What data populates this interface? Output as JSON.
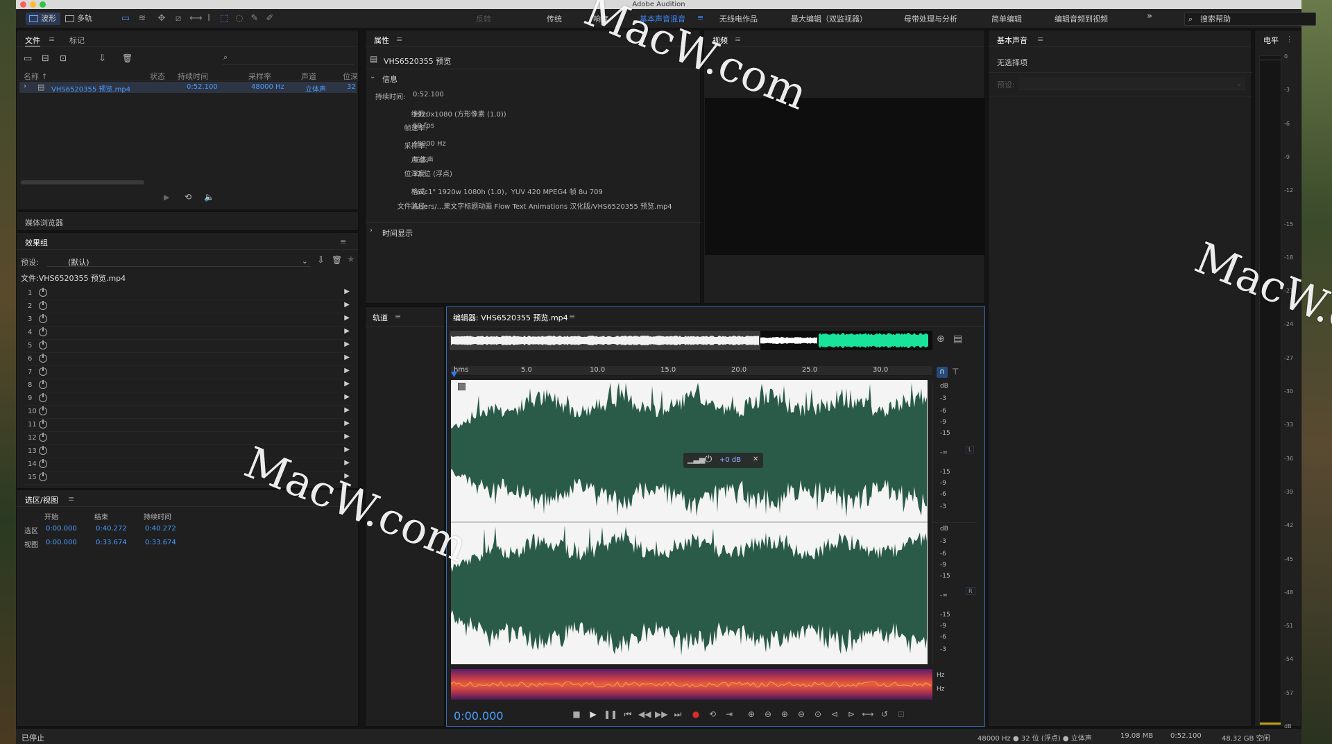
{
  "window": {
    "title": "Adobe Audition"
  },
  "toolbar": {
    "waveform_label": "波形",
    "multitrack_label": "多轨",
    "workspaces": [
      "反转",
      "传统",
      "响度",
      "基本声音混音",
      "无线电作品",
      "最大编辑（双监视器）",
      "母带处理与分析",
      "简单编辑",
      "编辑音频到视频"
    ],
    "active_workspace": "基本声音混音",
    "more_label": "»",
    "search_placeholder": "搜索帮助"
  },
  "files_panel": {
    "tab_files": "文件",
    "tab_markers": "标记",
    "columns": [
      "名称 ↑",
      "状态",
      "持续时间",
      "采样率",
      "声道",
      "位深"
    ],
    "file": {
      "name": "VHS6520355 预览.mp4",
      "duration": "0:52.100",
      "sample_rate": "48000 Hz",
      "channels": "立体声",
      "bit_depth": "32"
    }
  },
  "media_browser": {
    "title": "媒体浏览器"
  },
  "effects_rack": {
    "title": "效果组",
    "preset_label": "预设:",
    "preset_value": "(默认)",
    "file_label": "文件:VHS6520355 预览.mp4",
    "slots": [
      "1",
      "2",
      "3",
      "4",
      "5",
      "6",
      "7",
      "8",
      "9",
      "10",
      "11",
      "12",
      "13",
      "14",
      "15"
    ]
  },
  "selection_view": {
    "title": "选区/视图",
    "headers": [
      "开始",
      "结束",
      "持续时间"
    ],
    "selection": {
      "label": "选区",
      "start": "0:00.000",
      "end": "0:40.272",
      "duration": "0:40.272"
    },
    "view": {
      "label": "视图",
      "start": "0:00.000",
      "end": "0:33.674",
      "duration": "0:33.674"
    }
  },
  "properties": {
    "title": "属性",
    "file_name": "VHS6520355 预览",
    "info_title": "信息",
    "duration_label": "持续时间:",
    "duration_value": "0:52.100",
    "fields": [
      {
        "label": "维数:",
        "value": "1920x1080 (方形像素 (1.0))"
      },
      {
        "label": "帧速率:",
        "value": "60 fps"
      },
      {
        "label": "采样率:",
        "value": "48000 Hz"
      },
      {
        "label": "声道:",
        "value": "立体声"
      },
      {
        "label": "位深度:",
        "value": "32 位 (浮点)"
      },
      {
        "label": "格式:",
        "value": "\"avc1\" 1920w 1080h (1.0)，YUV 420 MPEG4 帧 8u 709"
      },
      {
        "label": "文件路径:",
        "value": "/Users/...果文字标题动画 Flow Text Animations 汉化版/VHS6520355 预览.mp4"
      }
    ],
    "time_display": "时间显示"
  },
  "video_panel": {
    "title": "视频"
  },
  "essential_sound": {
    "title": "基本声音",
    "no_selection": "无选择项",
    "preset_label": "预设:"
  },
  "level_meter": {
    "title": "电平",
    "scale": [
      "0",
      "-3",
      "-6",
      "-9",
      "-12",
      "-15",
      "-18",
      "-21",
      "-24",
      "-27",
      "-30",
      "-33",
      "-36",
      "-39",
      "-42",
      "-45",
      "-48",
      "-51",
      "-54",
      "-57",
      "dB"
    ]
  },
  "tracks_panel": {
    "title": "轨道"
  },
  "editor": {
    "title": "编辑器: VHS6520355 预览.mp4",
    "ruler": [
      "hms",
      "5.0",
      "10.0",
      "15.0",
      "20.0",
      "25.0",
      "30.0"
    ],
    "db_scale_top": [
      "dB",
      "-3",
      "-6",
      "-9",
      "-15",
      "-∞",
      "-15",
      "-9",
      "-6",
      "-3"
    ],
    "db_scale_bottom": [
      "dB",
      "-3",
      "-6",
      "-9",
      "-15",
      "-∞",
      "-15",
      "-9",
      "-6",
      "-3"
    ],
    "channel_left": "L",
    "channel_right": "R",
    "hud_gain": "+0 dB",
    "hz_label": "Hz",
    "current_time": "0:00.000"
  },
  "status_bar": {
    "state": "已停止",
    "sample_info": "48000 Hz ● 32 位 (浮点) ● 立体声",
    "size": "19.08 MB",
    "duration": "0:52.100",
    "free_space": "48.32 GB 空闲"
  },
  "watermark": {
    "text": "MacW.com"
  },
  "colors": {
    "accent": "#3d86f7",
    "waveform": "#2a5a48",
    "overview": "#19e39a",
    "record": "#e02a2a"
  }
}
